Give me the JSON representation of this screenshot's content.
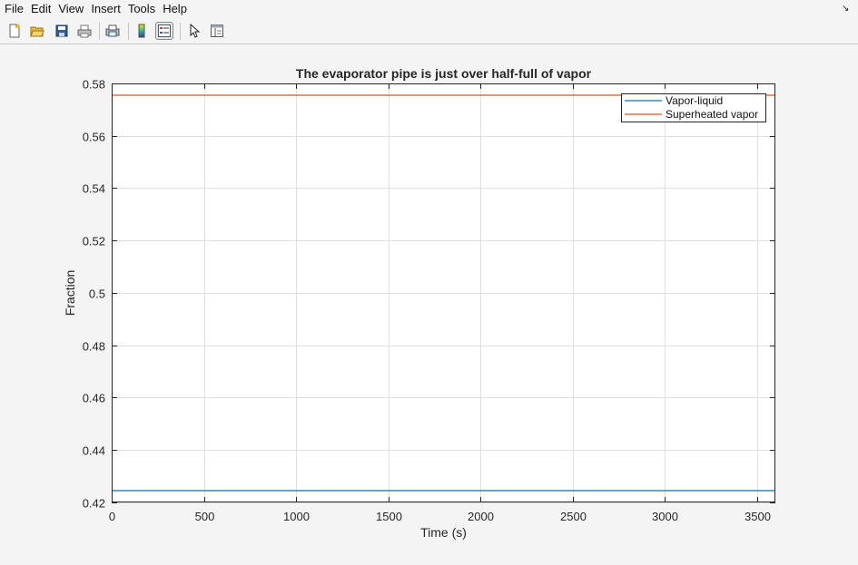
{
  "menubar": {
    "items": [
      {
        "label": "File"
      },
      {
        "label": "Edit"
      },
      {
        "label": "View"
      },
      {
        "label": "Insert"
      },
      {
        "label": "Tools"
      },
      {
        "label": "Help"
      }
    ]
  },
  "toolbar": {
    "buttons": [
      {
        "icon": "new-figure-icon"
      },
      {
        "icon": "open-file-icon"
      },
      {
        "icon": "save-icon"
      },
      {
        "icon": "print-icon"
      },
      {
        "icon": "print-preview-icon"
      },
      {
        "icon": "colorbar-icon"
      },
      {
        "icon": "legend-icon",
        "active": true
      },
      {
        "icon": "pointer-icon"
      },
      {
        "icon": "property-editor-icon"
      }
    ]
  },
  "colors": {
    "series1": "#0072bd",
    "series2": "#d95319",
    "axes_bg": "#ffffff",
    "grid": "#dfdfdf",
    "figure_bg": "#f4f4f4"
  },
  "chart_data": {
    "type": "line",
    "title": "The evaporator pipe is just over half-full of vapor",
    "xlabel": "Time (s)",
    "ylabel": "Fraction",
    "xlim": [
      0,
      3600
    ],
    "ylim": [
      0.42,
      0.58
    ],
    "xticks": [
      0,
      500,
      1000,
      1500,
      2000,
      2500,
      3000,
      3500
    ],
    "xtick_labels": [
      "0",
      "500",
      "1000",
      "1500",
      "2000",
      "2500",
      "3000",
      "3500"
    ],
    "yticks": [
      0.42,
      0.44,
      0.46,
      0.48,
      0.5,
      0.52,
      0.54,
      0.56,
      0.58
    ],
    "ytick_labels": [
      "0.42",
      "0.44",
      "0.46",
      "0.48",
      "0.5",
      "0.52",
      "0.54",
      "0.56",
      "0.58"
    ],
    "grid": true,
    "legend_position": "top-right",
    "series": [
      {
        "name": "Vapor-liquid",
        "color": "#0072bd",
        "x": [
          0,
          3600
        ],
        "y": [
          0.4245,
          0.4245
        ]
      },
      {
        "name": "Superheated vapor",
        "color": "#d95319",
        "x": [
          0,
          3600
        ],
        "y": [
          0.5755,
          0.5755
        ]
      }
    ]
  }
}
